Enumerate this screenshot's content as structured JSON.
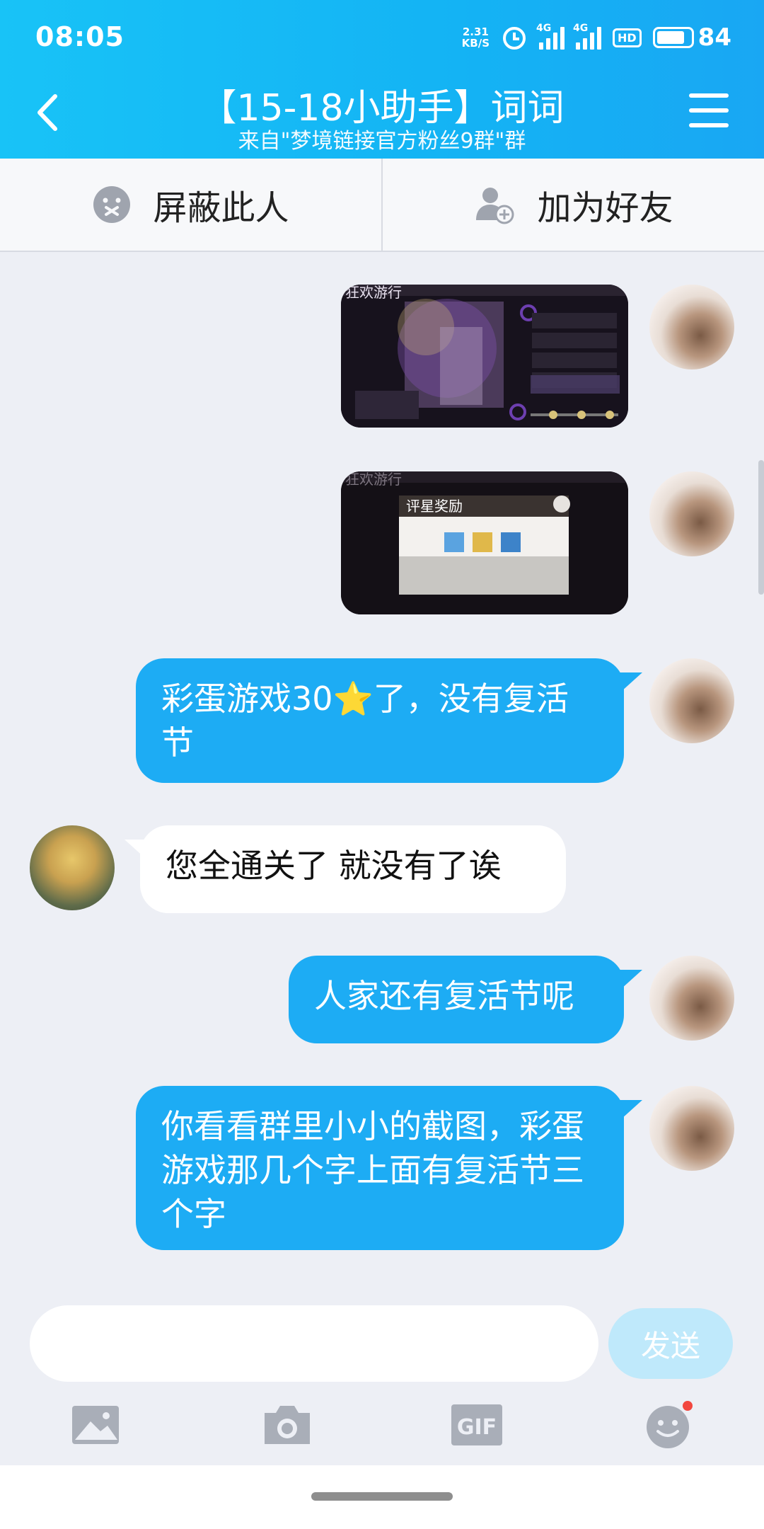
{
  "status_bar": {
    "time": "08:05",
    "net_speed_value": "2.31",
    "net_speed_unit": "KB/S",
    "signal1_label": "4G",
    "signal2_label": "4G",
    "hd_label": "HD",
    "battery": "84"
  },
  "header": {
    "title": "【15-18小助手】词词",
    "subtitle": "来自\"梦境链接官方粉丝9群\"群"
  },
  "actions": {
    "block_label": "屏蔽此人",
    "add_friend_label": "加为好友"
  },
  "messages": [
    {
      "sender": "me",
      "type": "image",
      "image_title": "狂欢游行"
    },
    {
      "sender": "me",
      "type": "image",
      "image_title": "评星奖励"
    },
    {
      "sender": "me",
      "type": "text",
      "text_before": "彩蛋游戏30",
      "emoji": "⭐",
      "text_after": "了，没有复活节"
    },
    {
      "sender": "other",
      "type": "text",
      "text": "您全通关了 就没有了诶"
    },
    {
      "sender": "me",
      "type": "text",
      "text": "人家还有复活节呢"
    },
    {
      "sender": "me",
      "type": "text",
      "text": "你看看群里小小的截图，彩蛋游戏那几个字上面有复活节三个字"
    }
  ],
  "input": {
    "placeholder": "",
    "send_label": "发送"
  },
  "toolbar": {
    "gif_label": "GIF"
  },
  "colors": {
    "header_blue": "#14b3f4",
    "bubble_blue": "#1dacf4",
    "send_disabled": "#bfe9fb",
    "notification_dot": "#f2473f"
  }
}
